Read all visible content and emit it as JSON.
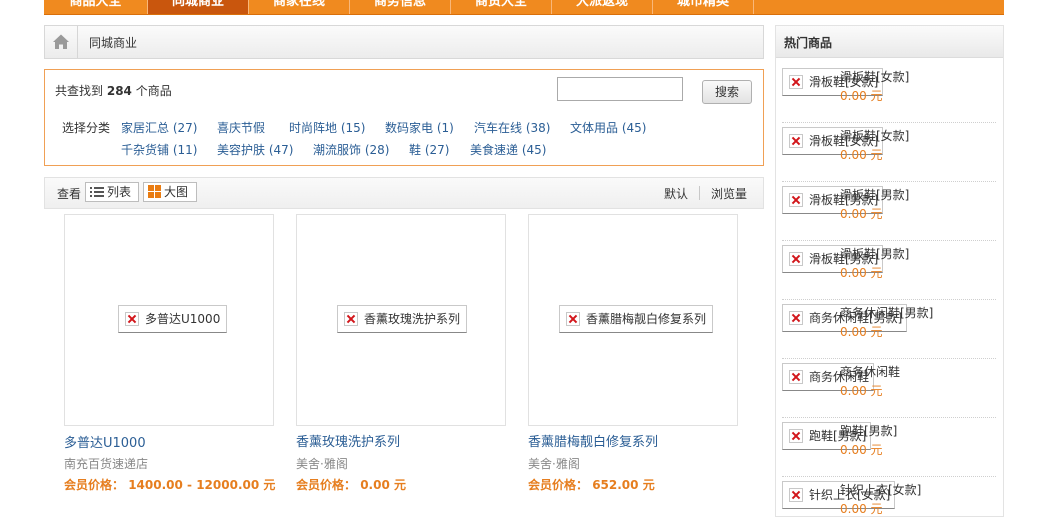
{
  "nav": {
    "tabs": [
      "商品大全",
      "同城商业",
      "商家在线",
      "商务信息",
      "商贸大全",
      "大派返现",
      "城市精英"
    ]
  },
  "breadcrumb": {
    "current": "同城商业"
  },
  "search": {
    "found_prefix": "共查找到",
    "found_count": "284",
    "found_suffix": "个商品",
    "input_value": "",
    "button_label": "搜索",
    "category_label": "选择分类",
    "categories": [
      "家居汇总 (27)",
      "喜庆节假",
      "时尚阵地 (15)",
      "数码家电 (1)",
      "汽车在线 (38)",
      "文体用品 (45)",
      "千杂货铺 (11)",
      "美容护肤 (47)",
      "潮流服饰 (28)",
      "鞋 (27)",
      "美食速递 (45)"
    ]
  },
  "viewbar": {
    "label": "查看",
    "list_label": "列表",
    "grid_label": "大图",
    "sort_default": "默认",
    "sort_views": "浏览量"
  },
  "products": [
    {
      "alt": "多普达U1000",
      "name": "多普达U1000",
      "store": "南充百货速递店",
      "price_label": "会员价格：",
      "price": "1400.00 - 12000.00 元"
    },
    {
      "alt": "香薰玫瑰洗护系列",
      "name": "香薰玫瑰洗护系列",
      "store": "美舍·雅阁",
      "price_label": "会员价格：",
      "price": "0.00 元"
    },
    {
      "alt": "香薰腊梅靓白修复系列",
      "name": "香薰腊梅靓白修复系列",
      "store": "美舍·雅阁",
      "price_label": "会员价格：",
      "price": "652.00 元"
    }
  ],
  "hot": {
    "title": "热门商品",
    "items": [
      {
        "alt": "滑板鞋[女款]",
        "name": "滑板鞋[女款]",
        "price": "0.00 元"
      },
      {
        "alt": "滑板鞋[女款]",
        "name": "滑板鞋[女款]",
        "price": "0.00 元"
      },
      {
        "alt": "滑板鞋[男款]",
        "name": "滑板鞋[男款]",
        "price": "0.00 元"
      },
      {
        "alt": "滑板鞋[男款]",
        "name": "滑板鞋[男款]",
        "price": "0.00 元"
      },
      {
        "alt": "商务休闲鞋[男款]",
        "name": "商务休闲鞋[男款]",
        "price": "0.00 元"
      },
      {
        "alt": "商务休闲鞋",
        "name": "商务休闲鞋",
        "price": "0.00 元"
      },
      {
        "alt": "跑鞋[男款]",
        "name": "跑鞋[男款]",
        "price": "0.00 元"
      },
      {
        "alt": "针织上衣[女款]",
        "name": "针织上衣[女款]",
        "price": "0.00 元"
      }
    ]
  },
  "colors": {
    "nav": "#f08a1f",
    "nav_active": "#c9560d",
    "link": "#2b5e95",
    "price": "#e67e1f",
    "border_accent": "#f0a055"
  }
}
